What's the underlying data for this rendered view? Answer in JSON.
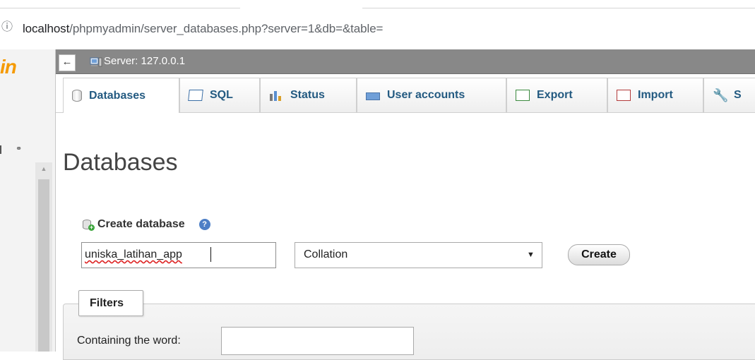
{
  "browser": {
    "url_host": "localhost",
    "url_rest": "/phpmyadmin/server_databases.php?server=1&db=&table=",
    "info_icon": "info-circle-icon"
  },
  "navigation": {
    "logo_fragment": "in",
    "link_icon": "chain-link-icon",
    "scroll_up_glyph": "▲"
  },
  "serverbar": {
    "collapse_glyph": "←",
    "server_label": "Server: 127.0.0.1",
    "server_icon": "server-icon"
  },
  "tabs": [
    {
      "label": "Databases",
      "icon": "database-icon",
      "active": true
    },
    {
      "label": "SQL",
      "icon": "sql-icon"
    },
    {
      "label": "Status",
      "icon": "status-chart-icon"
    },
    {
      "label": "User accounts",
      "icon": "user-accounts-icon"
    },
    {
      "label": "Export",
      "icon": "export-icon"
    },
    {
      "label": "Import",
      "icon": "import-icon"
    },
    {
      "label": "S",
      "icon": "wrench-icon"
    }
  ],
  "main": {
    "title": "Databases",
    "create": {
      "label": "Create database",
      "help_glyph": "?",
      "db_name_value": "uniska_latihan_app",
      "collation_value": "Collation",
      "select_arrow": "▼",
      "create_button": "Create"
    },
    "filters": {
      "legend": "Filters",
      "containing_label": "Containing the word:",
      "containing_value": ""
    }
  },
  "colors": {
    "tab_text": "#235a81",
    "serverbar_bg": "#888888",
    "logo_orange": "#f59a00"
  }
}
